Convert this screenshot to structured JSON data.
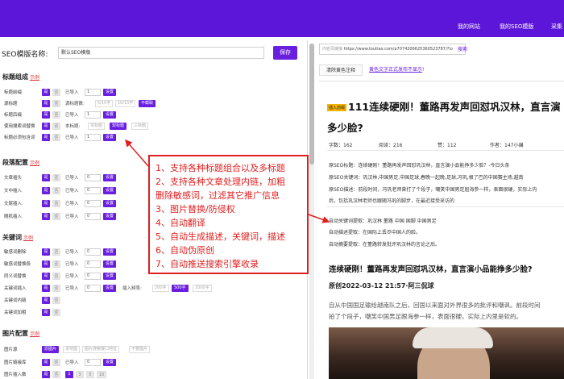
{
  "top_nav": {
    "my_site": "我的网站",
    "my_seo_template": "我的SEO模版",
    "collect": "采集"
  },
  "editor": {
    "name_label": "SEO模版名称:",
    "name_value": "默认SEO模版",
    "save_label": "保存",
    "example": "示例",
    "on": "是",
    "off": "否",
    "imported": "已导入",
    "zero": "0",
    "one": "1",
    "set": "设置",
    "sections": {
      "title": "标题组成",
      "paragraph": "段落配置",
      "keyword": "关键词",
      "image": "图片配置"
    },
    "title_rows": {
      "prefix": "标题前缀",
      "source": "源标题",
      "suffix": "标题后缀",
      "search_words": "使用搜索词替换",
      "must_contain": "标题必须包含词",
      "title_count": "源标题数:",
      "title_count_value": "5/10字",
      "title_count_value2": "10/15字",
      "no_limit": "不截取",
      "title_type": "本标题:",
      "title_type_value": "本标题",
      "double_title": "双标题",
      "triple_title": "三标题"
    },
    "para_rows": {
      "head": "文章插头",
      "mid": "文中插入",
      "tail": "文尾插入",
      "random": "随机插入"
    },
    "kw_rows": {
      "sensitive_del": "敏感词删除",
      "sensitive_replace": "敏感词替换段",
      "synonym": "同义词替换",
      "kw_insert": "关键词插入",
      "kw_link": "关键词内链",
      "kw_bold": "关键词加粗",
      "insert_freq": "插入频率:",
      "freq1": "200字",
      "freq2": "500字",
      "freq3": "1000字"
    },
    "img_rows": {
      "source": "图片源",
      "link_lib": "图片链接库",
      "insert_count": "图片插入数",
      "orig_img": "原图片",
      "local_img": "本地图",
      "api_img": "图片搜索接口地址",
      "no_img": "不要图片",
      "count_vals": [
        "1",
        "3",
        "5",
        "10"
      ]
    }
  },
  "preview": {
    "url_prefix": "内容页链接",
    "url_value": "https://www.toutiao.com/a7074206625360523787/?lo",
    "search": "搜索",
    "tab_clear": "清除黄色注释",
    "tab_note": "黄色文字正式发布不显示",
    "tab_note_suffix": "!",
    "chip_label": "插入前缀",
    "title_line1": "111连续硬刚！董路再发声回怼巩汉林，直言演",
    "title_line2": "多少脸?",
    "stats": {
      "words": "字数：162",
      "reads": "阅读：216",
      "likes": "赞：112",
      "author": "作者：147小编"
    },
    "seo": [
      "原SEO标题：连续硬刚！董路再发声回怼巩汉林，直言演小品能挣多少脸？-今日头条",
      "原SEO关键词：巩汉林,中国男足,中国足球,春晚一起晚,足球,冯巩,根了巴的中国赛主场,越南",
      "原SEO描述：前段时间，冯巩老师曾打了个段子，嘲笑中国男足屈海参一样，表面很硬，实际上内",
      "后，包括巩汉林老师也跟随冯巩的脚步，在最近接受采访的"
    ],
    "meta": {
      "kw": "自动关键词提取：巩汉林 董路 中国 国脚 中国男足",
      "desc": "自动描述提取：在国际上丢尽中国人的脸。",
      "summary": "自动摘要提取：在董路转发批评巩汉林的言论之后。"
    },
    "headline": "连续硬刚！董路再发声回怼巩汉林，直言演小品能挣多少脸?",
    "date_line": "原创2022-03-12 21:57·阿三侃球",
    "body": [
      "自从中国国足输给越南队之后，回国以来面对外界很多的批评和嘲讽。前段时间",
      "拍了个段子，嘲笑中国男足跟海参一样，表面很硬，实际上内里是软的。"
    ]
  },
  "overlay": {
    "lines": [
      "1、支持各种标题组合以及多标题",
      "2、支持各种文章处理内链，加粗",
      "删除敏感词，过滤其它推广信息",
      "3、图片替换/防侵权",
      "4、自动翻译",
      "5、自动生成描述，关键词，描述",
      "6、自动伪原创",
      "7、自动推送搜索引擎收录"
    ]
  },
  "colors": {
    "brand_purple": "#5b16d9",
    "accent_purple": "#6a1fe0",
    "overlay_red": "#e02020",
    "chip_yellow": "#f3b400"
  },
  "icons": [
    "arrow-icon"
  ]
}
